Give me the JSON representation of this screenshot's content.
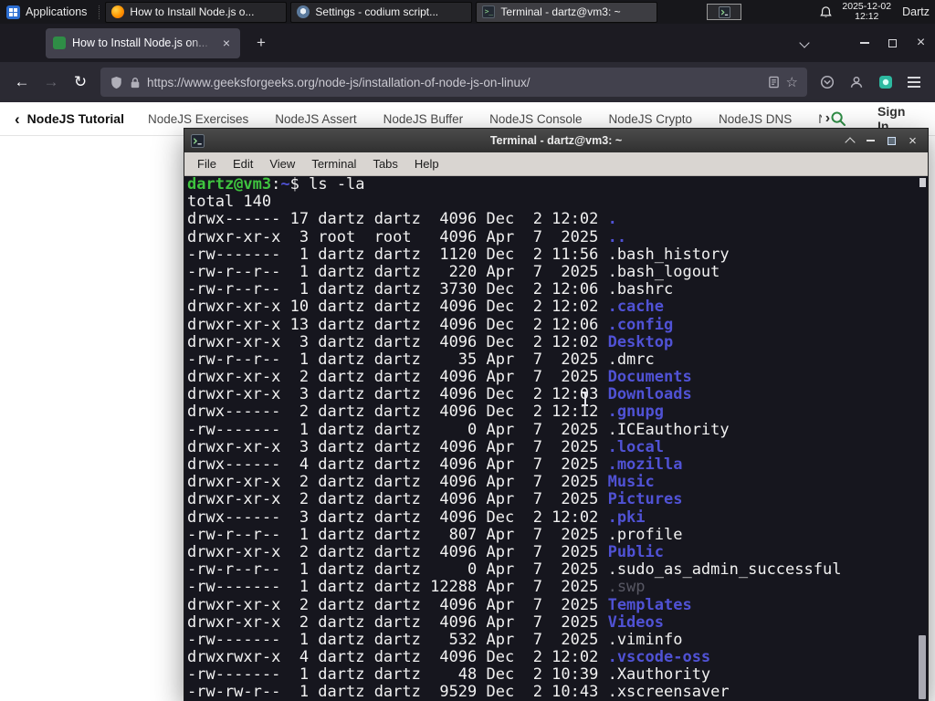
{
  "panel": {
    "applications": "Applications",
    "tasks": [
      {
        "label": "How to Install Node.js o...",
        "icon": "firefox",
        "active": false
      },
      {
        "label": "Settings - codium script...",
        "icon": "settings",
        "active": false
      },
      {
        "label": "Terminal - dartz@vm3: ~",
        "icon": "terminal",
        "active": true
      }
    ],
    "clock": {
      "date": "2025-12-02",
      "time": "12:12"
    },
    "user": "Dartz"
  },
  "browser": {
    "tab_title": "How to Install Node.js on...",
    "url": "https://www.geeksforgeeks.org/node-js/installation-of-node-js-on-linux/",
    "site_nav": {
      "tutorial": "NodeJS Tutorial",
      "links": [
        "NodeJS Exercises",
        "NodeJS Assert",
        "NodeJS Buffer",
        "NodeJS Console",
        "NodeJS Crypto",
        "NodeJS DNS",
        "Node"
      ],
      "sign_in": "Sign In"
    }
  },
  "terminal": {
    "title": "Terminal - dartz@vm3: ~",
    "menu": [
      "File",
      "Edit",
      "View",
      "Terminal",
      "Tabs",
      "Help"
    ],
    "prompt_user": "dartz@vm3",
    "prompt_path": "~",
    "command": "ls -la",
    "total_line": "total 140",
    "listing": [
      [
        "drwx------",
        "17",
        "dartz",
        "dartz",
        "4096",
        "Dec",
        "2",
        "12:02",
        ".",
        "dir"
      ],
      [
        "drwxr-xr-x",
        "3",
        "root",
        "root",
        "4096",
        "Apr",
        "7",
        "2025",
        "..",
        "dir"
      ],
      [
        "-rw-------",
        "1",
        "dartz",
        "dartz",
        "1120",
        "Dec",
        "2",
        "11:56",
        ".bash_history",
        "file"
      ],
      [
        "-rw-r--r--",
        "1",
        "dartz",
        "dartz",
        "220",
        "Apr",
        "7",
        "2025",
        ".bash_logout",
        "file"
      ],
      [
        "-rw-r--r--",
        "1",
        "dartz",
        "dartz",
        "3730",
        "Dec",
        "2",
        "12:06",
        ".bashrc",
        "file"
      ],
      [
        "drwxr-xr-x",
        "10",
        "dartz",
        "dartz",
        "4096",
        "Dec",
        "2",
        "12:02",
        ".cache",
        "dir"
      ],
      [
        "drwxr-xr-x",
        "13",
        "dartz",
        "dartz",
        "4096",
        "Dec",
        "2",
        "12:06",
        ".config",
        "dir"
      ],
      [
        "drwxr-xr-x",
        "3",
        "dartz",
        "dartz",
        "4096",
        "Dec",
        "2",
        "12:02",
        "Desktop",
        "dir"
      ],
      [
        "-rw-r--r--",
        "1",
        "dartz",
        "dartz",
        "35",
        "Apr",
        "7",
        "2025",
        ".dmrc",
        "file"
      ],
      [
        "drwxr-xr-x",
        "2",
        "dartz",
        "dartz",
        "4096",
        "Apr",
        "7",
        "2025",
        "Documents",
        "dir"
      ],
      [
        "drwxr-xr-x",
        "3",
        "dartz",
        "dartz",
        "4096",
        "Dec",
        "2",
        "12:03",
        "Downloads",
        "dir"
      ],
      [
        "drwx------",
        "2",
        "dartz",
        "dartz",
        "4096",
        "Dec",
        "2",
        "12:12",
        ".gnupg",
        "dir"
      ],
      [
        "-rw-------",
        "1",
        "dartz",
        "dartz",
        "0",
        "Apr",
        "7",
        "2025",
        ".ICEauthority",
        "file"
      ],
      [
        "drwxr-xr-x",
        "3",
        "dartz",
        "dartz",
        "4096",
        "Apr",
        "7",
        "2025",
        ".local",
        "dir"
      ],
      [
        "drwx------",
        "4",
        "dartz",
        "dartz",
        "4096",
        "Apr",
        "7",
        "2025",
        ".mozilla",
        "dir"
      ],
      [
        "drwxr-xr-x",
        "2",
        "dartz",
        "dartz",
        "4096",
        "Apr",
        "7",
        "2025",
        "Music",
        "dir"
      ],
      [
        "drwxr-xr-x",
        "2",
        "dartz",
        "dartz",
        "4096",
        "Apr",
        "7",
        "2025",
        "Pictures",
        "dir"
      ],
      [
        "drwx------",
        "3",
        "dartz",
        "dartz",
        "4096",
        "Dec",
        "2",
        "12:02",
        ".pki",
        "dir"
      ],
      [
        "-rw-r--r--",
        "1",
        "dartz",
        "dartz",
        "807",
        "Apr",
        "7",
        "2025",
        ".profile",
        "file"
      ],
      [
        "drwxr-xr-x",
        "2",
        "dartz",
        "dartz",
        "4096",
        "Apr",
        "7",
        "2025",
        "Public",
        "dir"
      ],
      [
        "-rw-r--r--",
        "1",
        "dartz",
        "dartz",
        "0",
        "Apr",
        "7",
        "2025",
        ".sudo_as_admin_successful",
        "file"
      ],
      [
        "-rw-------",
        "1",
        "dartz",
        "dartz",
        "12288",
        "Apr",
        "7",
        "2025",
        ".swp",
        "dim"
      ],
      [
        "drwxr-xr-x",
        "2",
        "dartz",
        "dartz",
        "4096",
        "Apr",
        "7",
        "2025",
        "Templates",
        "dir"
      ],
      [
        "drwxr-xr-x",
        "2",
        "dartz",
        "dartz",
        "4096",
        "Apr",
        "7",
        "2025",
        "Videos",
        "dir"
      ],
      [
        "-rw-------",
        "1",
        "dartz",
        "dartz",
        "532",
        "Apr",
        "7",
        "2025",
        ".viminfo",
        "file"
      ],
      [
        "drwxrwxr-x",
        "4",
        "dartz",
        "dartz",
        "4096",
        "Dec",
        "2",
        "12:02",
        ".vscode-oss",
        "dir"
      ],
      [
        "-rw-------",
        "1",
        "dartz",
        "dartz",
        "48",
        "Dec",
        "2",
        "10:39",
        ".Xauthority",
        "file"
      ],
      [
        "-rw-rw-r--",
        "1",
        "dartz",
        "dartz",
        "9529",
        "Dec",
        "2",
        "10:43",
        ".xscreensaver",
        "file"
      ]
    ]
  },
  "colors": {
    "gfg_green": "#2f8d46",
    "terminal_background": "#16161e",
    "terminal_directory_blue": "#5052d5",
    "terminal_prompt_green": "#3fc43f",
    "firefox_tabbar": "#1c1b22",
    "firefox_toolbar": "#2b2a33",
    "firefox_urlbar": "#42414d",
    "panel_background": "#17171b"
  }
}
